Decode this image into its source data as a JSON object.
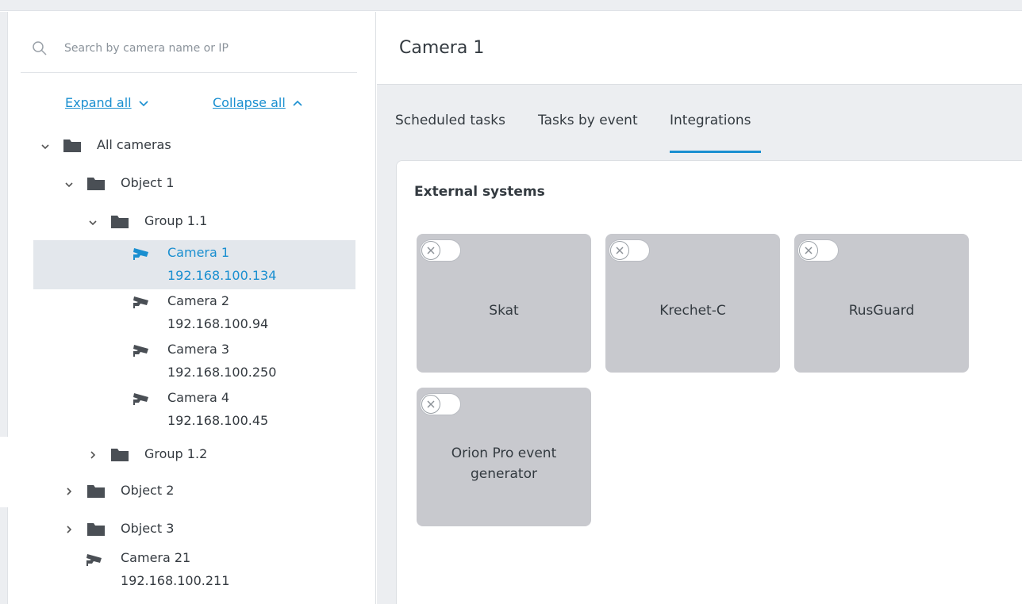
{
  "search": {
    "placeholder": "Search by camera name or IP"
  },
  "tree_controls": {
    "expand_label": "Expand all",
    "collapse_label": "Collapse all"
  },
  "tree": {
    "all_cameras": "All cameras",
    "object1": "Object 1",
    "group11": "Group 1.1",
    "cameras": [
      {
        "name": "Camera 1",
        "ip": "192.168.100.134"
      },
      {
        "name": "Camera 2",
        "ip": "192.168.100.94"
      },
      {
        "name": "Camera 3",
        "ip": "192.168.100.250"
      },
      {
        "name": "Camera 4",
        "ip": "192.168.100.45"
      }
    ],
    "group12": "Group 1.2",
    "object2": "Object 2",
    "object3": "Object 3",
    "camera21": {
      "name": "Camera 21",
      "ip": "192.168.100.211"
    }
  },
  "header": {
    "title": "Camera 1"
  },
  "tabs": [
    {
      "label": "Scheduled tasks"
    },
    {
      "label": "Tasks by event"
    },
    {
      "label": "Integrations"
    }
  ],
  "active_tab": "Integrations",
  "section": {
    "title": "External systems"
  },
  "integrations": [
    {
      "name": "Skat",
      "enabled": false
    },
    {
      "name": "Krechet-C",
      "enabled": false
    },
    {
      "name": "RusGuard",
      "enabled": false
    },
    {
      "name": "Orion Pro event generator",
      "enabled": false
    }
  ],
  "colors": {
    "accent": "#1a8fd0",
    "tile": "#c8c9ce",
    "panel": "#eceef1",
    "selected_row": "#e3e7ec"
  },
  "icons": [
    "search-icon",
    "chevron-down-icon",
    "chevron-up-icon",
    "chevron-right-icon",
    "folder-icon",
    "camera-icon",
    "close-icon"
  ]
}
